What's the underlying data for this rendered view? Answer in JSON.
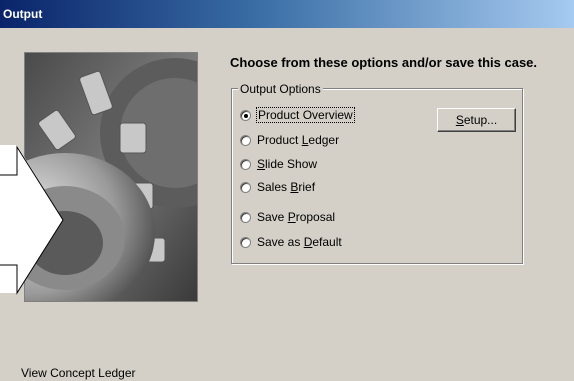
{
  "window": {
    "title": "Output"
  },
  "main": {
    "heading": "Choose from these options and/or save this case.",
    "group_label": "Output Options",
    "options": [
      {
        "pre": "Product Overview",
        "key": "",
        "post": "",
        "checked": true
      },
      {
        "pre": "Product ",
        "key": "L",
        "post": "edger",
        "checked": false
      },
      {
        "pre": "",
        "key": "S",
        "post": "lide Show",
        "checked": false
      },
      {
        "pre": "Sales ",
        "key": "B",
        "post": "rief",
        "checked": false
      },
      {
        "pre": "Save ",
        "key": "P",
        "post": "roposal",
        "checked": false
      },
      {
        "pre": "Save as ",
        "key": "D",
        "post": "efault",
        "checked": false
      }
    ],
    "setup_button": {
      "key": "S",
      "rest": "etup..."
    }
  },
  "status": {
    "text": "View Concept Ledger"
  },
  "colors": {
    "title_start": "#0a246a",
    "title_end": "#a6caf0",
    "face": "#d4d0c8"
  },
  "icons": {
    "image": "gear-photo",
    "arrow": "arrow-pointer"
  }
}
